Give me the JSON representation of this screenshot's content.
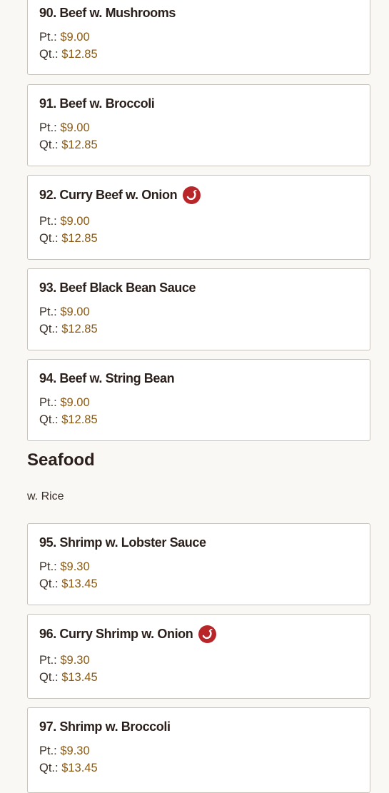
{
  "beef_items": [
    {
      "name": "90. Beef w. Mushrooms",
      "pt_label": "Pt.:",
      "pt": "$9.00",
      "qt_label": "Qt.:",
      "qt": "$12.85"
    },
    {
      "name": "91. Beef w. Broccoli",
      "pt_label": "Pt.:",
      "pt": "$9.00",
      "qt_label": "Qt.:",
      "qt": "$12.85"
    },
    {
      "name": "92. Curry Beef w. Onion",
      "pt_label": "Pt.:",
      "pt": "$9.00",
      "qt_label": "Qt.:",
      "qt": "$12.85",
      "spicy_icon": "chili-pepper-icon"
    },
    {
      "name": "93. Beef Black Bean Sauce",
      "pt_label": "Pt.:",
      "pt": "$9.00",
      "qt_label": "Qt.:",
      "qt": "$12.85"
    },
    {
      "name": "94. Beef w. String Bean",
      "pt_label": "Pt.:",
      "pt": "$9.00",
      "qt_label": "Qt.:",
      "qt": "$12.85"
    }
  ],
  "seafood": {
    "title": "Seafood",
    "subtitle": "w. Rice",
    "items": [
      {
        "name": "95. Shrimp w. Lobster Sauce",
        "pt_label": "Pt.:",
        "pt": "$9.30",
        "qt_label": "Qt.:",
        "qt": "$13.45"
      },
      {
        "name": "96. Curry Shrimp w. Onion",
        "pt_label": "Pt.:",
        "pt": "$9.30",
        "qt_label": "Qt.:",
        "qt": "$13.45",
        "spicy_icon": "chili-pepper-icon"
      },
      {
        "name": "97. Shrimp w. Broccoli",
        "pt_label": "Pt.:",
        "pt": "$9.30",
        "qt_label": "Qt.:",
        "qt": "$13.45"
      }
    ]
  },
  "colors": {
    "spicy_badge": "#b8262a",
    "price": "#8a5a14",
    "card_border": "#c8c2bc",
    "background": "#faf8f5"
  }
}
